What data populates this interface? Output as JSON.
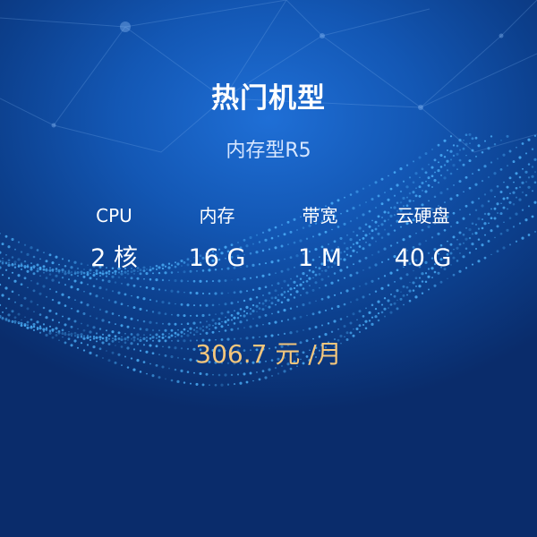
{
  "colors": {
    "background_top": "#1f6fd6",
    "background_bottom": "#0a2c6b",
    "text": "#ffffff",
    "subtitle": "#d6e6ff",
    "price": "#f3c67c",
    "particles": "#4fb6ff"
  },
  "card": {
    "title": "热门机型",
    "subtitle": "内存型R5",
    "specs": [
      {
        "label": "CPU",
        "value": "2 核"
      },
      {
        "label": "内存",
        "value": "16 G"
      },
      {
        "label": "带宽",
        "value": "1 M"
      },
      {
        "label": "云硬盘",
        "value": "40 G"
      }
    ],
    "price": "306.7 元 /月"
  }
}
